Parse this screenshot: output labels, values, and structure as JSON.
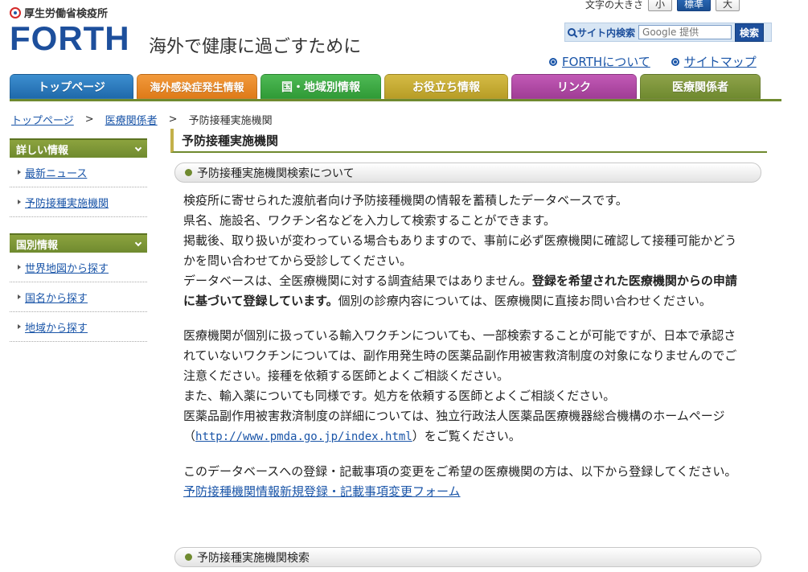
{
  "header": {
    "ministry": "厚生労働省検疫所",
    "logo": "FORTH",
    "tagline": "海外で健康に過ごすために",
    "text_size": {
      "label": "文字の大きさ",
      "small": "小",
      "standard": "標準",
      "large": "大"
    },
    "search": {
      "label": "サイト内検索",
      "placeholder": "Google 提供",
      "button": "検索"
    },
    "links": {
      "about": "FORTHについて",
      "sitemap": "サイトマップ"
    }
  },
  "nav": {
    "tabs": [
      {
        "label": "トップページ"
      },
      {
        "label": "海外感染症発生情報"
      },
      {
        "label": "国・地域別情報"
      },
      {
        "label": "お役立ち情報"
      },
      {
        "label": "リンク"
      },
      {
        "label": "医療関係者"
      }
    ]
  },
  "breadcrumb": {
    "items": [
      "トップページ",
      "医療関係者",
      "予防接種実施機関"
    ],
    "sep": ">"
  },
  "sidebar": {
    "section1": {
      "title": "詳しい情報",
      "items": [
        "最新ニュース",
        "予防接種実施機関"
      ]
    },
    "section2": {
      "title": "国別情報",
      "items": [
        "世界地図から探す",
        "国名から探す",
        "地域から探す"
      ]
    }
  },
  "main": {
    "title": "予防接種実施機関",
    "section1_title": "予防接種実施機関検索について",
    "p1_l1": "検疫所に寄せられた渡航者向け予防接種機関の情報を蓄積したデータベースです。",
    "p1_l2": "県名、施設名、ワクチン名などを入力して検索することができます。",
    "p1_l3": "掲載後、取り扱いが変わっている場合もありますので、事前に必ず医療機関に確認して接種可能かどうかを問い合わせてから受診してください。",
    "p1_l4a": "データベースは、全医療機関に対する調査結果ではありません。",
    "p1_l4b": "登録を希望された医療機関からの申請に基づいて登録しています。",
    "p1_l4c": "個別の診療内容については、医療機関に直接お問い合わせください。",
    "p2_l1": "医療機関が個別に扱っている輸入ワクチンについても、一部検索することが可能ですが、日本で承認されていないワクチンについては、副作用発生時の医薬品副作用被害救済制度の対象になりませんのでご注意ください。接種を依頼する医師とよくご相談ください。",
    "p2_l2": "また、輸入薬についても同様です。処方を依頼する医師とよくご相談ください。",
    "p2_l3a": "医薬品副作用被害救済制度の詳細については、独立行政法人医薬品医療機器総合機構のホームページ（",
    "p2_link": "http://www.pmda.go.jp/index.html",
    "p2_l3b": "）をご覧ください。",
    "p3_l1": "このデータベースへの登録・記載事項の変更をご希望の医療機関の方は、以下から登録してください。",
    "p3_link": "予防接種機関情報新規登録・記載事項変更フォーム",
    "section2_title": "予防接種実施機関検索"
  },
  "colors": {
    "brand_blue": "#1d4f9c",
    "link_blue": "#1a55a8",
    "medical_green": "#6f8a2f"
  }
}
